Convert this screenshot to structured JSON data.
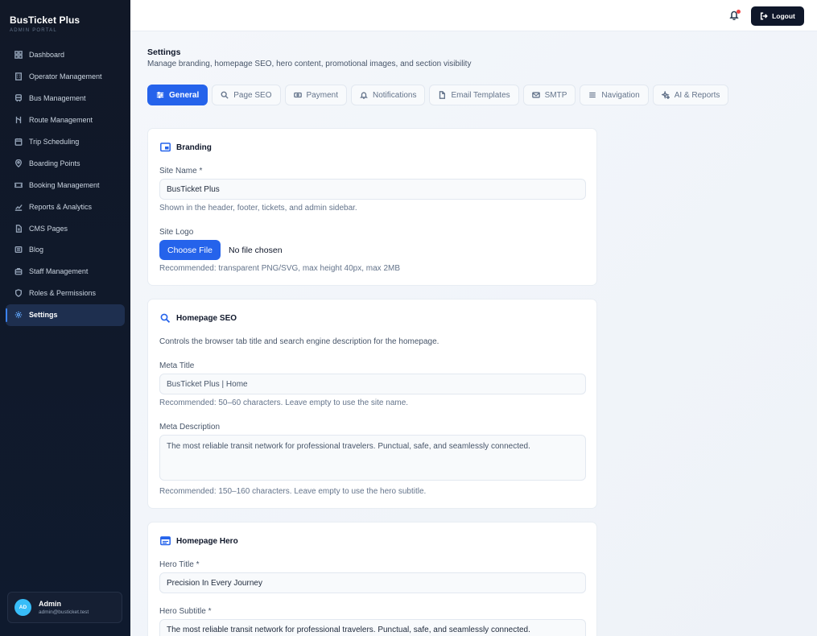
{
  "app": {
    "name": "BusTicket Plus",
    "subtitle": "ADMIN PORTAL"
  },
  "sidebar": {
    "items": [
      {
        "label": "Dashboard",
        "icon": "dashboard-icon"
      },
      {
        "label": "Operator Management",
        "icon": "building-icon"
      },
      {
        "label": "Bus Management",
        "icon": "bus-icon"
      },
      {
        "label": "Route Management",
        "icon": "route-icon"
      },
      {
        "label": "Trip Scheduling",
        "icon": "calendar-icon"
      },
      {
        "label": "Boarding Points",
        "icon": "map-pin-icon"
      },
      {
        "label": "Booking Management",
        "icon": "ticket-icon"
      },
      {
        "label": "Reports & Analytics",
        "icon": "chart-icon"
      },
      {
        "label": "CMS Pages",
        "icon": "file-icon"
      },
      {
        "label": "Blog",
        "icon": "newspaper-icon"
      },
      {
        "label": "Staff Management",
        "icon": "briefcase-icon"
      },
      {
        "label": "Roles & Permissions",
        "icon": "shield-icon"
      },
      {
        "label": "Settings",
        "icon": "gear-icon",
        "active": true
      }
    ]
  },
  "user": {
    "initials": "AD",
    "name": "Admin",
    "email": "admin@busticket.test"
  },
  "topbar": {
    "logout_label": "Logout"
  },
  "page": {
    "title": "Settings",
    "subtitle": "Manage branding, homepage SEO, hero content, promotional images, and section visibility"
  },
  "tabs": [
    {
      "label": "General",
      "icon": "sliders-icon",
      "active": true
    },
    {
      "label": "Page SEO",
      "icon": "seo-search-icon"
    },
    {
      "label": "Payment",
      "icon": "money-icon"
    },
    {
      "label": "Notifications",
      "icon": "bell-icon"
    },
    {
      "label": "Email Templates",
      "icon": "document-icon"
    },
    {
      "label": "SMTP",
      "icon": "mail-icon"
    },
    {
      "label": "Navigation",
      "icon": "menu-icon"
    },
    {
      "label": "AI & Reports",
      "icon": "sparkles-icon"
    }
  ],
  "branding": {
    "title": "Branding",
    "site_name_label": "Site Name *",
    "site_name_value": "BusTicket Plus",
    "site_name_hint": "Shown in the header, footer, tickets, and admin sidebar.",
    "logo_label": "Site Logo",
    "choose_file": "Choose File",
    "no_file": "No file chosen",
    "logo_hint": "Recommended: transparent PNG/SVG, max height 40px, max 2MB"
  },
  "seo": {
    "title": "Homepage SEO",
    "description": "Controls the browser tab title and search engine description for the homepage.",
    "meta_title_label": "Meta Title",
    "meta_title_placeholder": "BusTicket Plus | Home",
    "meta_title_hint": "Recommended: 50–60 characters. Leave empty to use the site name.",
    "meta_desc_label": "Meta Description",
    "meta_desc_placeholder": "The most reliable transit network for professional travelers. Punctual, safe, and seamlessly connected.",
    "meta_desc_hint": "Recommended: 150–160 characters. Leave empty to use the hero subtitle."
  },
  "hero": {
    "title": "Homepage Hero",
    "hero_title_label": "Hero Title *",
    "hero_title_value": "Precision In Every Journey",
    "hero_subtitle_label": "Hero Subtitle *",
    "hero_subtitle_value": "The most reliable transit network for professional travelers. Punctual, safe, and seamlessly connected."
  },
  "colors": {
    "accent": "#2563eb",
    "sidebar": "#111827",
    "notification_dot": "#ef4444",
    "avatar": "#38bdf8"
  }
}
